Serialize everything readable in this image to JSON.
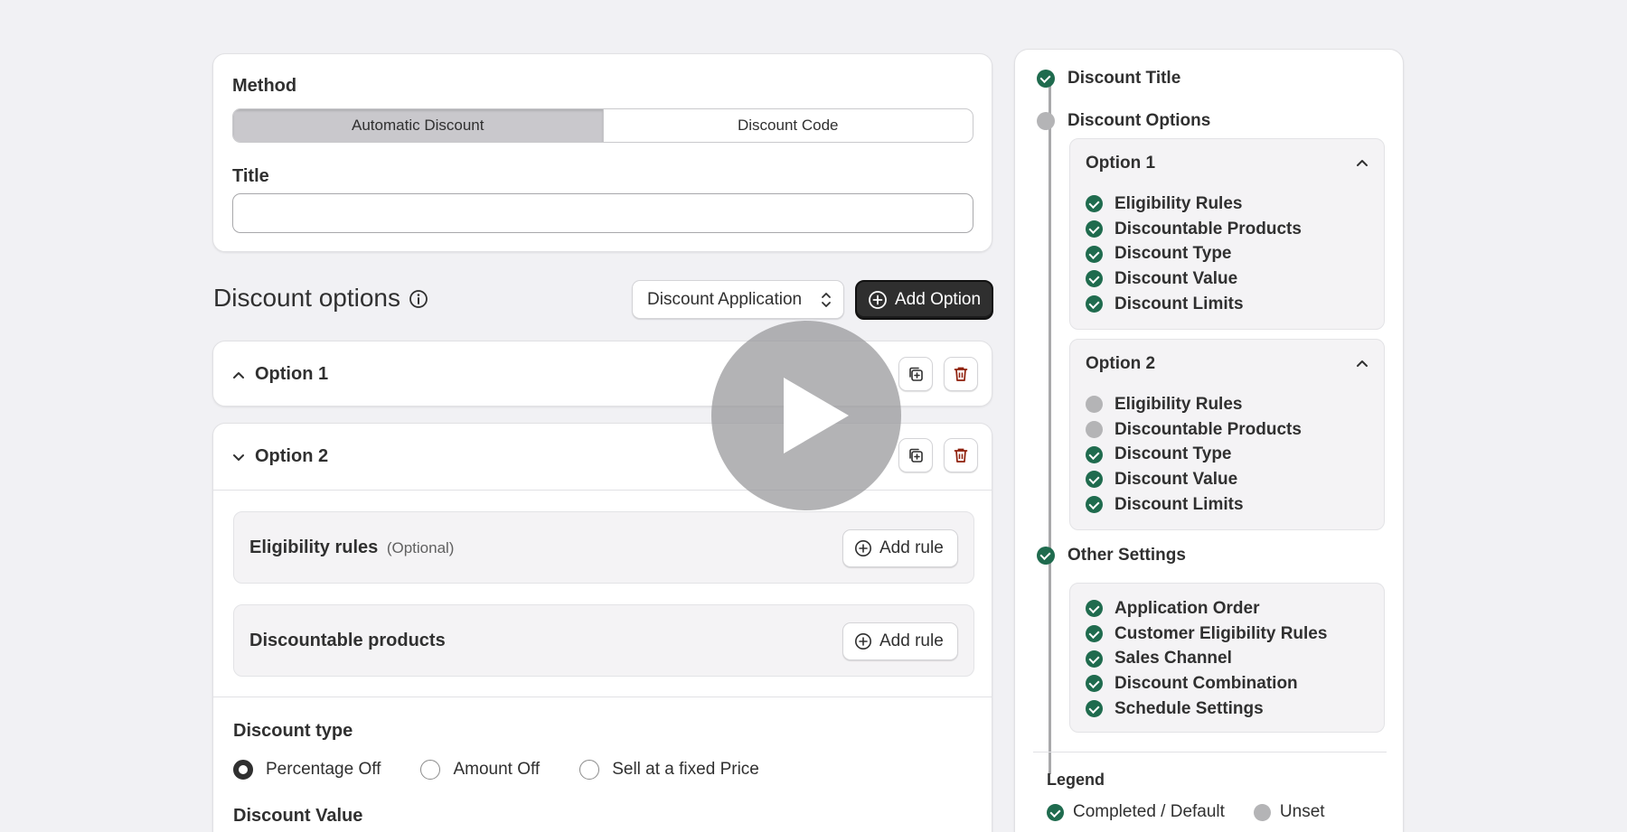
{
  "method": {
    "label": "Method",
    "options": [
      "Automatic Discount",
      "Discount Code"
    ],
    "selected": "Automatic Discount"
  },
  "title_field": {
    "label": "Title",
    "value": "",
    "placeholder": ""
  },
  "options_header": {
    "heading": "Discount options",
    "application_select": "Discount Application",
    "add_option": "Add Option"
  },
  "options": [
    {
      "label": "Option 1",
      "expanded": false
    },
    {
      "label": "Option 2",
      "expanded": true
    }
  ],
  "option2_body": {
    "eligibility": {
      "label": "Eligibility rules",
      "optional": "(Optional)",
      "button": "Add rule"
    },
    "discountable": {
      "label": "Discountable products",
      "button": "Add rule"
    },
    "discount_type": {
      "label": "Discount type",
      "choices": [
        "Percentage Off",
        "Amount Off",
        "Sell at a fixed Price"
      ],
      "selected": "Percentage Off"
    },
    "discount_value_label": "Discount Value"
  },
  "status_panel": {
    "discount_title": {
      "label": "Discount Title",
      "status": "complete"
    },
    "discount_options": {
      "label": "Discount Options",
      "status": "unset"
    },
    "option_boxes": [
      {
        "title": "Option 1",
        "items": [
          {
            "label": "Eligibility Rules",
            "status": "complete"
          },
          {
            "label": "Discountable Products",
            "status": "complete"
          },
          {
            "label": "Discount Type",
            "status": "complete"
          },
          {
            "label": "Discount Value",
            "status": "complete"
          },
          {
            "label": "Discount Limits",
            "status": "complete"
          }
        ]
      },
      {
        "title": "Option 2",
        "items": [
          {
            "label": "Eligibility Rules",
            "status": "unset"
          },
          {
            "label": "Discountable Products",
            "status": "unset"
          },
          {
            "label": "Discount Type",
            "status": "complete"
          },
          {
            "label": "Discount Value",
            "status": "complete"
          },
          {
            "label": "Discount Limits",
            "status": "complete"
          }
        ]
      }
    ],
    "other_settings": {
      "label": "Other Settings",
      "status": "complete",
      "items": [
        {
          "label": "Application Order",
          "status": "complete"
        },
        {
          "label": "Customer Eligibility Rules",
          "status": "complete"
        },
        {
          "label": "Sales Channel",
          "status": "complete"
        },
        {
          "label": "Discount Combination",
          "status": "complete"
        },
        {
          "label": "Schedule Settings",
          "status": "complete"
        }
      ]
    },
    "legend": {
      "title": "Legend",
      "completed": "Completed / Default",
      "unset": "Unset"
    }
  },
  "colors": {
    "complete": "#1f6b4e",
    "unset": "#b4b4b6",
    "delete_icon": "#8e1f0b",
    "primary_button": "#2f2f2f"
  },
  "icons": [
    "info-icon",
    "chevron-up-icon",
    "chevron-down-icon",
    "duplicate-icon",
    "trash-icon",
    "plus-circle-icon",
    "select-chevrons-icon",
    "play-icon"
  ]
}
